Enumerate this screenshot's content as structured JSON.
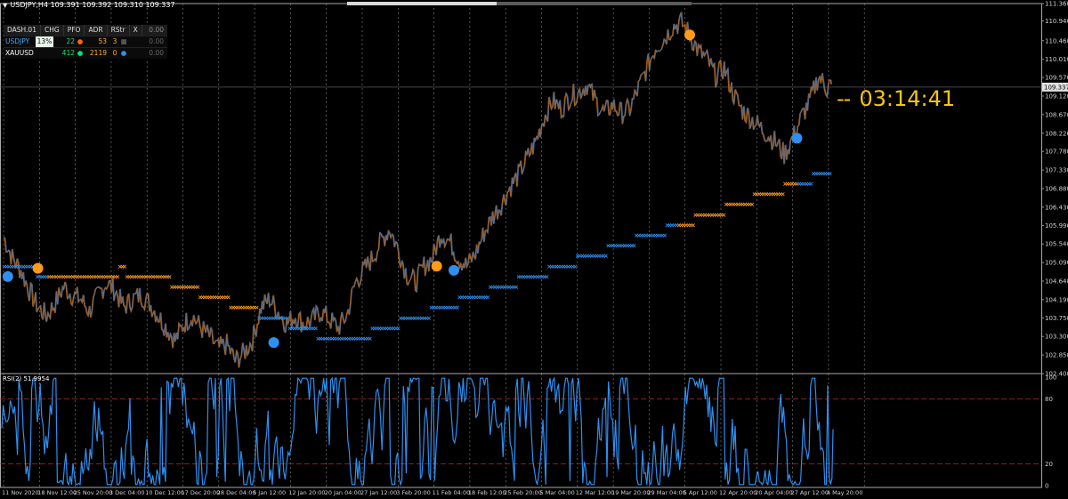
{
  "title": "USDJPY,H4  109.391 109.392 109.310 109.337",
  "dashboard": {
    "headers": [
      "DASH.01",
      "CHG",
      "PFO",
      "ADR",
      "RStr",
      "X"
    ],
    "header_value": "0.00",
    "rows": [
      {
        "symbol": "USDJPY",
        "chg": "13%",
        "pfo": "22",
        "adr": "53",
        "rstr": "3",
        "value": "0.00",
        "dot_color": "#ff6a00",
        "symbol_color": "#3aa8ff"
      },
      {
        "symbol": "XAUUSD",
        "chg": "",
        "pfo": "412",
        "adr": "2119",
        "rstr": "0",
        "value": "0.00",
        "dot_color": "#00e676",
        "symbol_color": "#ffffff"
      }
    ]
  },
  "countdown": "03:14:41",
  "rsi_title": "RSI(2) 51.9954",
  "price_axis": [
    "111.360",
    "110.940",
    "110.460",
    "110.010",
    "109.570",
    "109.337",
    "109.120",
    "108.670",
    "108.220",
    "107.780",
    "107.330",
    "106.880",
    "106.430",
    "105.990",
    "105.540",
    "105.090",
    "104.640",
    "104.190",
    "103.750",
    "103.300",
    "102.850",
    "102.400"
  ],
  "current_price": "109.337",
  "rsi_axis": [
    "100",
    "80",
    "20",
    "0"
  ],
  "time_axis": [
    "11 Nov 2020",
    "18 Nov 12:00",
    "25 Nov 20:00",
    "3 Dec 04:00",
    "10 Dec 12:00",
    "17 Dec 20:00",
    "28 Dec 04:00",
    "5 Jan 12:00",
    "12 Jan 20:00",
    "20 Jan 04:00",
    "27 Jan 12:00",
    "3 Feb 20:00",
    "11 Feb 04:00",
    "18 Feb 12:00",
    "25 Feb 20:00",
    "5 Mar 04:00",
    "12 Mar 12:00",
    "19 Mar 20:00",
    "29 Mar 04:00",
    "5 Apr 12:00",
    "12 Apr 20:00",
    "20 Apr 04:00",
    "27 Apr 12:00",
    "4 May 20:00"
  ],
  "colors": {
    "bull": "#2f8ff0",
    "bear": "#ff9a1a",
    "countdown": "#f5c518",
    "rsi_level": "#c0242c"
  },
  "chart_data": {
    "type": "line",
    "symbol": "USDJPY",
    "timeframe": "H4",
    "ylim": [
      102.4,
      111.36
    ],
    "price_path": [
      [
        0,
        105.7
      ],
      [
        2,
        105.2
      ],
      [
        4,
        104.9
      ],
      [
        6,
        104.4
      ],
      [
        8,
        104.0
      ],
      [
        10,
        103.8
      ],
      [
        12,
        104.1
      ],
      [
        14,
        104.5
      ],
      [
        16,
        104.3
      ],
      [
        18,
        104.2
      ],
      [
        20,
        103.9
      ],
      [
        22,
        104.3
      ],
      [
        24,
        104.6
      ],
      [
        26,
        104.4
      ],
      [
        28,
        104.0
      ],
      [
        30,
        104.2
      ],
      [
        32,
        104.3
      ],
      [
        34,
        104.1
      ],
      [
        36,
        103.8
      ],
      [
        38,
        103.5
      ],
      [
        40,
        103.2
      ],
      [
        42,
        103.6
      ],
      [
        44,
        103.8
      ],
      [
        46,
        103.5
      ],
      [
        48,
        103.3
      ],
      [
        50,
        103.0
      ],
      [
        52,
        103.1
      ],
      [
        54,
        102.7
      ],
      [
        56,
        102.9
      ],
      [
        58,
        103.2
      ],
      [
        60,
        104.0
      ],
      [
        62,
        104.2
      ],
      [
        64,
        103.9
      ],
      [
        66,
        103.6
      ],
      [
        68,
        103.8
      ],
      [
        70,
        103.6
      ],
      [
        72,
        103.7
      ],
      [
        74,
        103.9
      ],
      [
        76,
        103.7
      ],
      [
        78,
        103.5
      ],
      [
        80,
        103.8
      ],
      [
        82,
        104.6
      ],
      [
        84,
        104.9
      ],
      [
        86,
        105.2
      ],
      [
        88,
        105.6
      ],
      [
        90,
        105.9
      ],
      [
        92,
        105.4
      ],
      [
        94,
        104.8
      ],
      [
        96,
        104.6
      ],
      [
        98,
        105.0
      ],
      [
        100,
        105.2
      ],
      [
        102,
        105.8
      ],
      [
        104,
        105.6
      ],
      [
        106,
        105.2
      ],
      [
        108,
        105.0
      ],
      [
        110,
        105.3
      ],
      [
        112,
        105.8
      ],
      [
        114,
        106.2
      ],
      [
        116,
        106.5
      ],
      [
        118,
        106.9
      ],
      [
        120,
        107.2
      ],
      [
        122,
        107.6
      ],
      [
        124,
        108.0
      ],
      [
        126,
        108.6
      ],
      [
        128,
        109.0
      ],
      [
        130,
        108.8
      ],
      [
        132,
        109.1
      ],
      [
        134,
        109.2
      ],
      [
        136,
        109.4
      ],
      [
        138,
        109.0
      ],
      [
        140,
        108.7
      ],
      [
        142,
        108.9
      ],
      [
        144,
        108.7
      ],
      [
        146,
        108.8
      ],
      [
        148,
        109.3
      ],
      [
        150,
        109.8
      ],
      [
        152,
        110.3
      ],
      [
        154,
        110.5
      ],
      [
        156,
        110.8
      ],
      [
        158,
        110.9
      ],
      [
        160,
        110.6
      ],
      [
        162,
        110.2
      ],
      [
        164,
        110.0
      ],
      [
        166,
        109.6
      ],
      [
        168,
        109.8
      ],
      [
        170,
        109.2
      ],
      [
        172,
        108.8
      ],
      [
        174,
        108.6
      ],
      [
        176,
        108.4
      ],
      [
        178,
        108.2
      ],
      [
        180,
        108.0
      ],
      [
        182,
        107.7
      ],
      [
        184,
        108.1
      ],
      [
        186,
        108.6
      ],
      [
        188,
        109.0
      ],
      [
        190,
        109.6
      ],
      [
        192,
        109.3
      ],
      [
        193,
        109.4
      ]
    ],
    "rsi": {
      "period": 2,
      "last": 51.9954,
      "levels": [
        20,
        80
      ],
      "ylim": [
        0,
        100
      ]
    }
  }
}
